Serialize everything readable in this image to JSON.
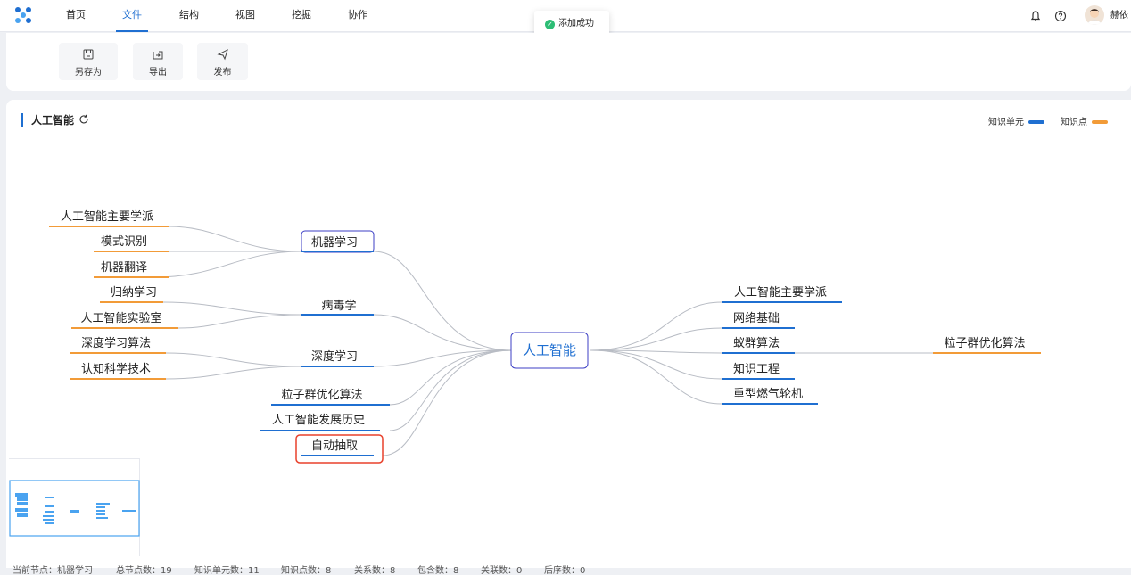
{
  "nav": {
    "items": [
      "首页",
      "文件",
      "结构",
      "视图",
      "挖掘",
      "协作"
    ],
    "active": "文件"
  },
  "toast": {
    "text": "添加成功",
    "color": "#2dbd75"
  },
  "user": {
    "name": "赫依"
  },
  "toolbar": {
    "save_as": "另存为",
    "export": "导出",
    "publish": "发布"
  },
  "map": {
    "title": "人工智能",
    "legend": {
      "unit_label": "知识单元",
      "unit_color": "#1f6fd1",
      "point_label": "知识点",
      "point_color": "#f29b38"
    },
    "root": "人工智能",
    "left": {
      "machine_learning": {
        "label": "机器学习",
        "children": [
          "人工智能主要学派",
          "模式识别",
          "机器翻译"
        ]
      },
      "virology": {
        "label": "病毒学",
        "children": [
          "归纳学习",
          "人工智能实验室"
        ]
      },
      "deep_learning": {
        "label": "深度学习",
        "children": [
          "深度学习算法",
          "认知科学技术"
        ]
      },
      "pso": "粒子群优化算法",
      "history": "人工智能发展历史",
      "auto_extract": "自动抽取"
    },
    "right": {
      "items": [
        "人工智能主要学派",
        "网络基础",
        "蚁群算法",
        "知识工程",
        "重型燃气轮机"
      ],
      "ant_child": "粒子群优化算法"
    }
  },
  "status": {
    "current_node_label": "当前节点：",
    "current_node": "机器学习",
    "total_nodes": "总节点数：19",
    "units": "知识单元数：11",
    "points": "知识点数：8",
    "relations": "关系数：8",
    "contains": "包含数：8",
    "associations": "关联数：0",
    "order": "后序数：0"
  }
}
